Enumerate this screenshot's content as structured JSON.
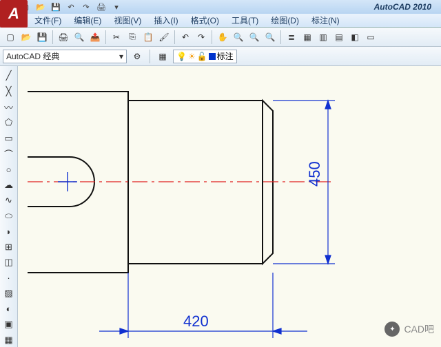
{
  "app": {
    "title": "AutoCAD 2010"
  },
  "menu": {
    "file": "文件(F)",
    "edit": "编辑(E)",
    "view": "视图(V)",
    "insert": "插入(I)",
    "format": "格式(O)",
    "tools": "工具(T)",
    "draw": "绘图(D)",
    "dimension": "标注(N)"
  },
  "props": {
    "workspace": "AutoCAD 经典",
    "layer_name": "标注"
  },
  "drawing": {
    "dim_h": "420",
    "dim_v": "450"
  },
  "watermark": {
    "text": "CAD吧"
  },
  "colors": {
    "dim": "#1030d0",
    "center": "#e02020",
    "geom": "#101010"
  }
}
